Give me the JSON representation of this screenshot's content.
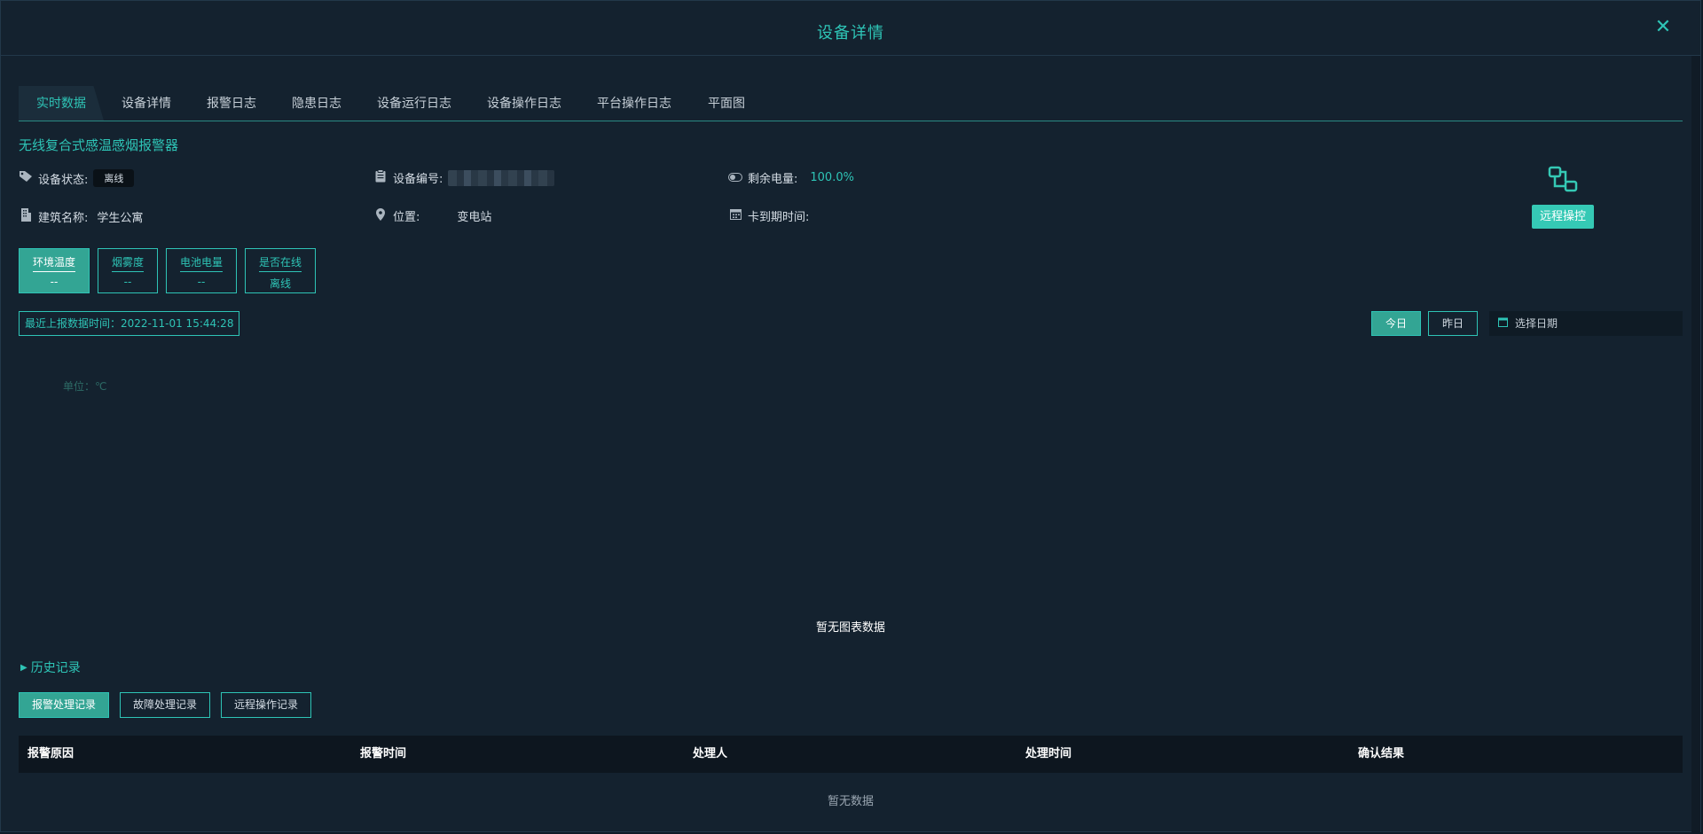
{
  "dialog": {
    "title": "设备详情",
    "close_icon": "close-icon"
  },
  "tabs": [
    {
      "label": "实时数据",
      "active": true
    },
    {
      "label": "设备详情"
    },
    {
      "label": "报警日志"
    },
    {
      "label": "隐患日志"
    },
    {
      "label": "设备运行日志"
    },
    {
      "label": "设备操作日志"
    },
    {
      "label": "平台操作日志"
    },
    {
      "label": "平面图"
    }
  ],
  "device": {
    "name": "无线复合式感温感烟报警器",
    "status_label": "设备状态:",
    "status_value": "离线",
    "serial_label": "设备编号:",
    "battery_label": "剩余电量:",
    "battery_value": "100.0%",
    "building_label": "建筑名称:",
    "building_value": "学生公寓",
    "location_label": "位置:",
    "location_value": "变电站",
    "card_expiry_label": "卡到期时间:",
    "card_expiry_value": ""
  },
  "remote": {
    "button_label": "远程操控"
  },
  "metrics": [
    {
      "label": "环境温度",
      "value": "--",
      "active": true
    },
    {
      "label": "烟雾度",
      "value": "--"
    },
    {
      "label": "电池电量",
      "value": "--"
    },
    {
      "label": "是否在线",
      "value": "离线"
    }
  ],
  "last_report": "最近上报数据时间：2022-11-01 15:44:28",
  "date_filter": {
    "today": "今日",
    "yesterday": "昨日",
    "placeholder": "选择日期"
  },
  "chart": {
    "unit": "单位：℃",
    "empty": "暂无图表数据"
  },
  "history": {
    "toggle_label": "历史记录",
    "buttons": [
      "报警处理记录",
      "故障处理记录",
      "远程操作记录"
    ],
    "columns": [
      "报警原因",
      "报警时间",
      "处理人",
      "处理时间",
      "确认结果"
    ],
    "empty": "暂无数据"
  },
  "colors": {
    "accent": "#2ec4b6",
    "accent_fill": "#33a594",
    "background": "#14222f"
  }
}
